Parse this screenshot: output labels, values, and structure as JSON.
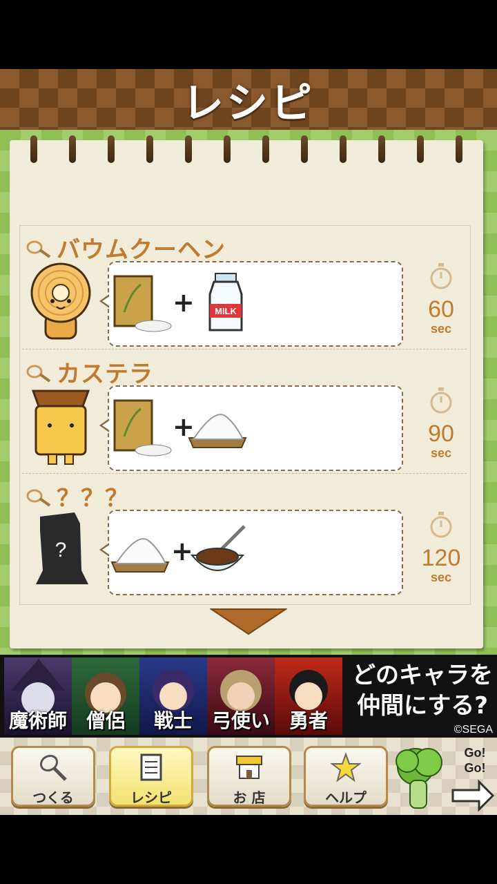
{
  "header": {
    "title": "レシピ"
  },
  "recipes": [
    {
      "name": "バウムクーヘン",
      "time": "60",
      "unit": "sec",
      "ingredients": [
        "flour-sack",
        "milk-bottle"
      ]
    },
    {
      "name": "カステラ",
      "time": "90",
      "unit": "sec",
      "ingredients": [
        "flour-sack",
        "sugar-pile"
      ]
    },
    {
      "name": "？？？",
      "time": "120",
      "unit": "sec",
      "ingredients": [
        "sugar-pile",
        "chocolate-bowl"
      ]
    }
  ],
  "plus": "+",
  "mystery_mark": "?",
  "milk_label": "MILK",
  "ad": {
    "chars": [
      "魔術師",
      "僧侶",
      "戦士",
      "弓使い",
      "勇者"
    ],
    "line1": "どのキャラを",
    "line2": "仲間にする?",
    "copyright": "©SEGA"
  },
  "nav": [
    {
      "label": "つくる",
      "icon": "whisk-icon",
      "active": false
    },
    {
      "label": "レシピ",
      "icon": "notepad-icon",
      "active": true
    },
    {
      "label": "お 店",
      "icon": "shop-icon",
      "active": false
    },
    {
      "label": "ヘルプ",
      "icon": "star-icon",
      "active": false
    }
  ],
  "gogo": {
    "text1": "Go!",
    "text2": "Go!"
  },
  "colors": {
    "accent": "#c17b2e",
    "header_brown": "#8a5a2e",
    "green": "#8fbf55"
  }
}
